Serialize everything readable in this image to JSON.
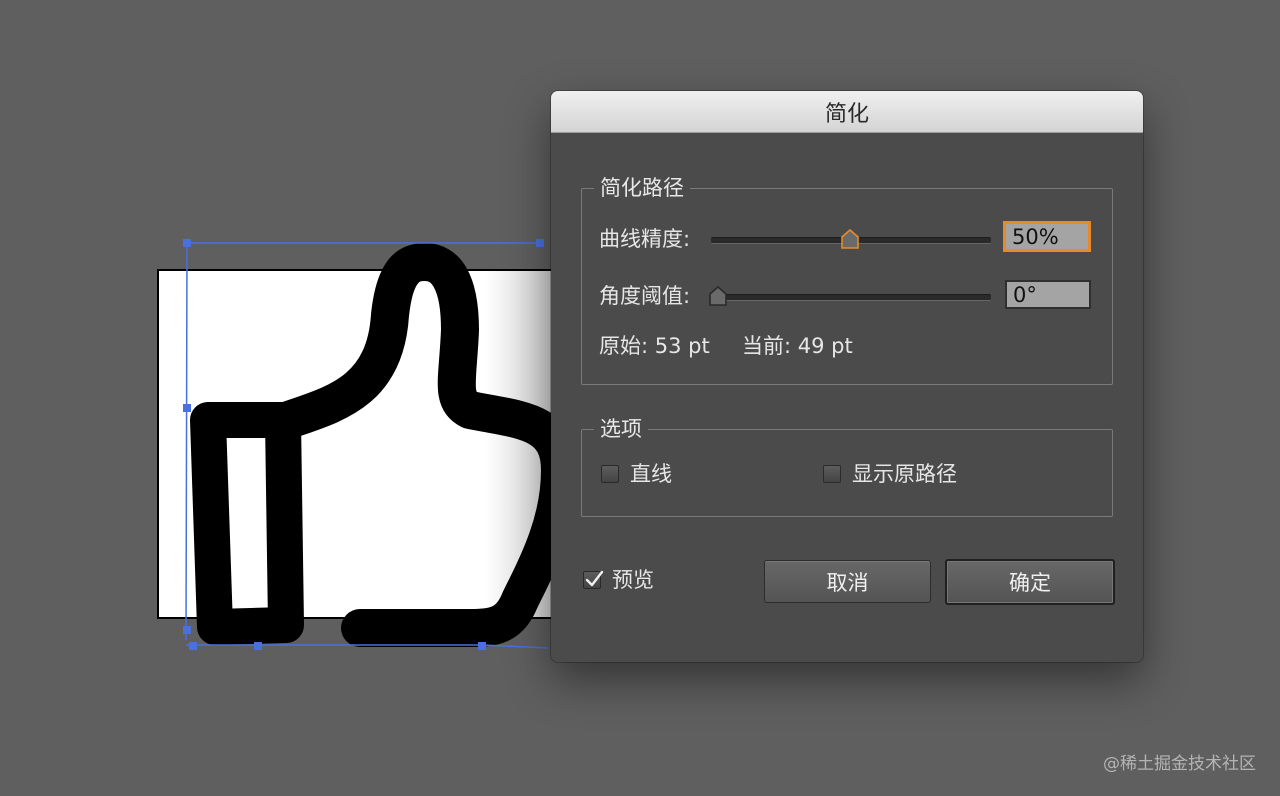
{
  "dialog": {
    "title": "简化",
    "simplify_path": {
      "legend": "简化路径",
      "curve_precision": {
        "label": "曲线精度:",
        "value": "50%",
        "level": 0.5
      },
      "angle_threshold": {
        "label": "角度阈值:",
        "value": "0°",
        "level": 0.0
      },
      "original": "原始: 53 pt",
      "current": "当前: 49 pt"
    },
    "options": {
      "legend": "选项",
      "straight_lines": {
        "label": "直线",
        "checked": false
      },
      "show_original": {
        "label": "显示原路径",
        "checked": false
      }
    },
    "preview": {
      "label": "预览",
      "checked": true
    },
    "cancel_label": "取消",
    "ok_label": "确定"
  },
  "watermark": "@稀土掘金技术社区",
  "colors": {
    "canvas_bg": "#5f5f5f",
    "dialog_bg": "#4b4b4b",
    "selection": "#4a6fe0",
    "focus": "#e8892a"
  }
}
